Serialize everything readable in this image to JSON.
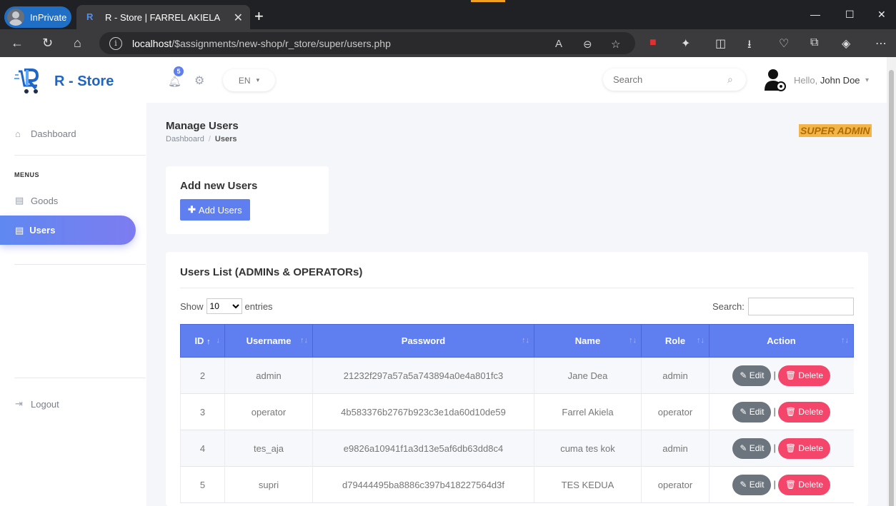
{
  "browser": {
    "inprivate_label": "InPrivate",
    "tab_title": "R - Store | FARREL AKIELA",
    "url_host": "localhost",
    "url_path": "/$assignments/new-shop/r_store/super/users.php"
  },
  "sidebar": {
    "brand": "R - Store",
    "dashboard": "Dashboard",
    "menus_heading": "MENUS",
    "goods": "Goods",
    "users": "Users",
    "logout": "Logout"
  },
  "topbar": {
    "notification_count": "5",
    "language": "EN",
    "search_placeholder": "Search",
    "hello": "Hello,",
    "user_name": "John Doe"
  },
  "page": {
    "title": "Manage Users",
    "breadcrumb_home": "Dashboard",
    "breadcrumb_current": "Users",
    "role_badge": "SUPER ADMIN"
  },
  "add_card": {
    "title": "Add new Users",
    "button": "Add Users"
  },
  "list_card": {
    "title": "Users List (ADMINs & OPERATORs)",
    "show_label": "Show",
    "entries_value": "10",
    "entries_label": "entries",
    "search_label": "Search:",
    "columns": [
      "ID",
      "Username",
      "Password",
      "Name",
      "Role",
      "Action"
    ],
    "edit_label": "Edit",
    "delete_label": "Delete",
    "rows": [
      {
        "id": "2",
        "username": "admin",
        "password": "21232f297a57a5a743894a0e4a801fc3",
        "name": "Jane Dea",
        "role": "admin"
      },
      {
        "id": "3",
        "username": "operator",
        "password": "4b583376b2767b923c3e1da60d10de59",
        "name": "Farrel Akiela",
        "role": "operator"
      },
      {
        "id": "4",
        "username": "tes_aja",
        "password": "e9826a10941f1a3d13e5af6db63dd8c4",
        "name": "cuma tes kok",
        "role": "admin"
      },
      {
        "id": "5",
        "username": "supri",
        "password": "d79444495ba8886c397b418227564d3f",
        "name": "TES KEDUA",
        "role": "operator"
      }
    ]
  }
}
